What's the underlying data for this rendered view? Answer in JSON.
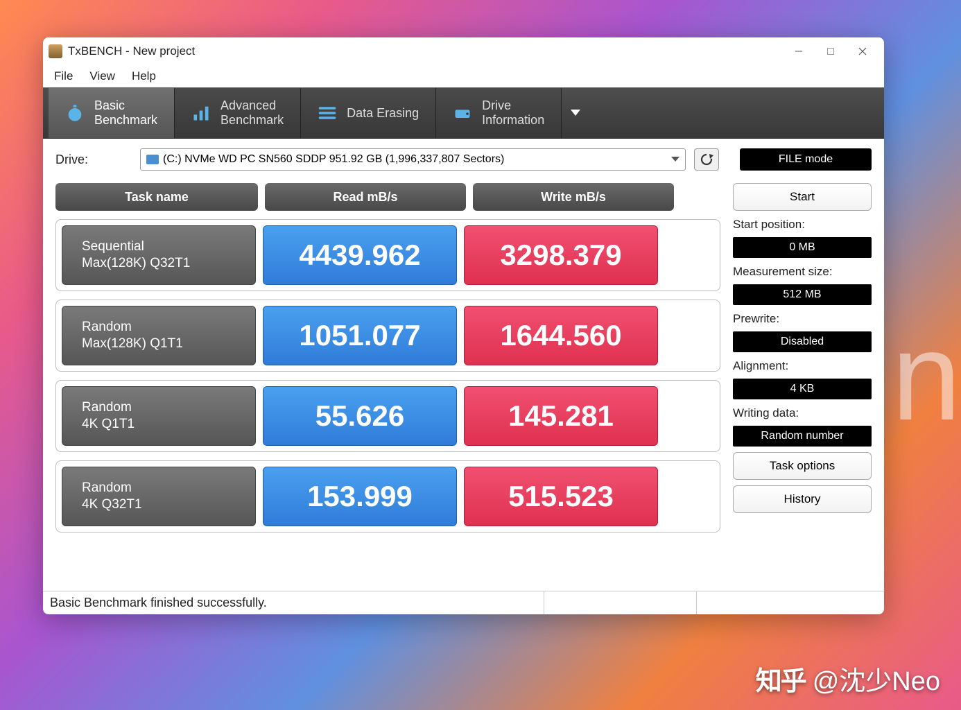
{
  "window": {
    "title": "TxBENCH - New project"
  },
  "menu": {
    "file": "File",
    "view": "View",
    "help": "Help"
  },
  "tabs": {
    "basic": "Basic\nBenchmark",
    "advanced": "Advanced\nBenchmark",
    "erase": "Data Erasing",
    "drive": "Drive\nInformation"
  },
  "drive": {
    "label": "Drive:",
    "value": "(C:) NVMe WD PC SN560 SDDP  951.92 GB (1,996,337,807 Sectors)"
  },
  "mode_button": "FILE mode",
  "headers": {
    "task": "Task name",
    "read": "Read mB/s",
    "write": "Write mB/s"
  },
  "rows": [
    {
      "name1": "Sequential",
      "name2": "Max(128K) Q32T1",
      "read": "4439.962",
      "write": "3298.379"
    },
    {
      "name1": "Random",
      "name2": "Max(128K) Q1T1",
      "read": "1051.077",
      "write": "1644.560"
    },
    {
      "name1": "Random",
      "name2": "4K Q1T1",
      "read": "55.626",
      "write": "145.281"
    },
    {
      "name1": "Random",
      "name2": "4K Q32T1",
      "read": "153.999",
      "write": "515.523"
    }
  ],
  "side": {
    "start": "Start",
    "start_pos_label": "Start position:",
    "start_pos_value": "0 MB",
    "meas_label": "Measurement size:",
    "meas_value": "512 MB",
    "prewrite_label": "Prewrite:",
    "prewrite_value": "Disabled",
    "align_label": "Alignment:",
    "align_value": "4 KB",
    "wdata_label": "Writing data:",
    "wdata_value": "Random number",
    "task_options": "Task options",
    "history": "History"
  },
  "status": "Basic Benchmark finished successfully.",
  "watermark": {
    "site": "知乎",
    "user": "@沈少Neo"
  }
}
